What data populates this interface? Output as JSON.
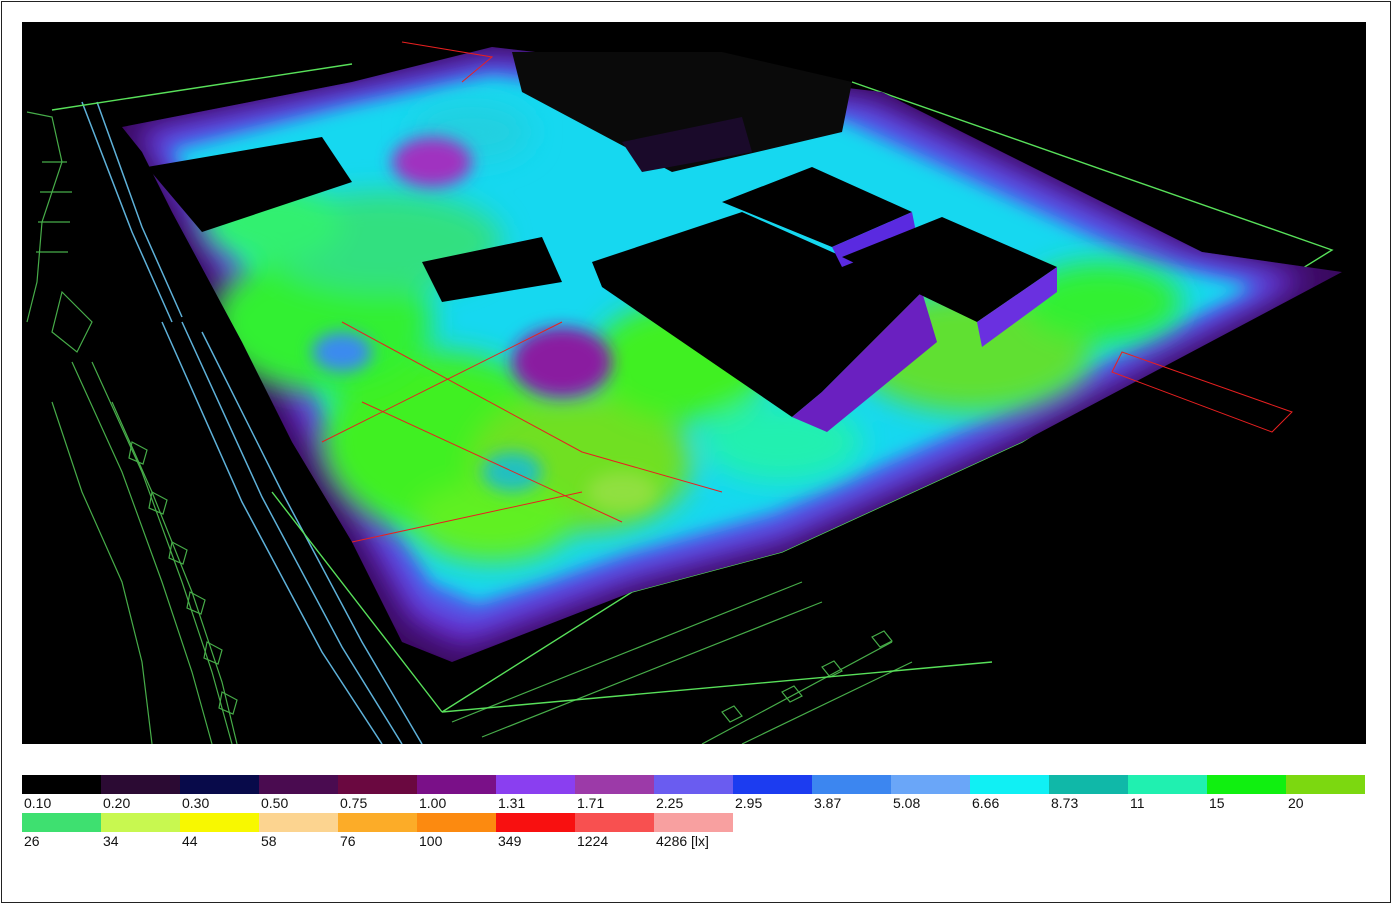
{
  "legend": {
    "row1": [
      {
        "value": "0.10",
        "color": "#000000"
      },
      {
        "value": "0.20",
        "color": "#2b0a33"
      },
      {
        "value": "0.30",
        "color": "#080a4a"
      },
      {
        "value": "0.50",
        "color": "#4a0b50"
      },
      {
        "value": "0.75",
        "color": "#6a0840"
      },
      {
        "value": "1.00",
        "color": "#7a1088"
      },
      {
        "value": "1.31",
        "color": "#8a3ff0"
      },
      {
        "value": "1.71",
        "color": "#9c3aa8"
      },
      {
        "value": "2.25",
        "color": "#6a5cf0"
      },
      {
        "value": "2.95",
        "color": "#1c3cf0"
      },
      {
        "value": "3.87",
        "color": "#3c86f0"
      },
      {
        "value": "5.08",
        "color": "#6aa6f8"
      },
      {
        "value": "6.66",
        "color": "#10f0f4"
      },
      {
        "value": "8.73",
        "color": "#10b8a8"
      },
      {
        "value": "11",
        "color": "#20f0b0"
      },
      {
        "value": "15",
        "color": "#10f010"
      },
      {
        "value": "20",
        "color": "#7cd810"
      }
    ],
    "row2": [
      {
        "value": "26",
        "color": "#3ee070"
      },
      {
        "value": "34",
        "color": "#c8f850"
      },
      {
        "value": "44",
        "color": "#f8f800"
      },
      {
        "value": "58",
        "color": "#fcd490"
      },
      {
        "value": "76",
        "color": "#fcac28"
      },
      {
        "value": "100",
        "color": "#fc8a10"
      },
      {
        "value": "349",
        "color": "#f81010"
      },
      {
        "value": "1224",
        "color": "#f85050"
      },
      {
        "value": "4286 [lx]",
        "color": "#f8a0a0"
      }
    ]
  }
}
